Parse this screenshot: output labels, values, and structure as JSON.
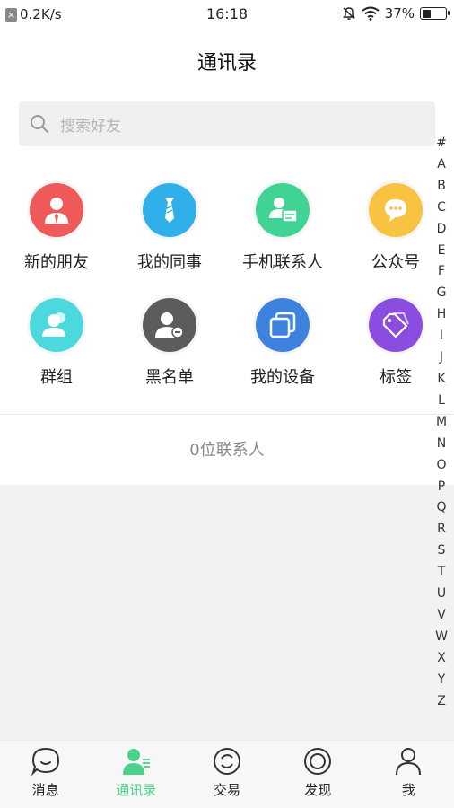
{
  "status": {
    "speed": "0.2K/s",
    "time": "16:18",
    "battery_pct": "37%",
    "battery_level": 0.37
  },
  "header": {
    "title": "通讯录"
  },
  "search": {
    "placeholder": "搜索好友"
  },
  "grid": [
    {
      "label": "新的朋友",
      "color": "#ee5a5a",
      "icon": "person-tie-icon"
    },
    {
      "label": "我的同事",
      "color": "#2fb0ea",
      "icon": "necktie-icon"
    },
    {
      "label": "手机联系人",
      "color": "#3fd494",
      "icon": "contact-card-icon"
    },
    {
      "label": "公众号",
      "color": "#f7c340",
      "icon": "chat-bubble-icon"
    },
    {
      "label": "群组",
      "color": "#4cd9dd",
      "icon": "group-icon"
    },
    {
      "label": "黑名单",
      "color": "#5c5c5c",
      "icon": "block-user-icon"
    },
    {
      "label": "我的设备",
      "color": "#3e82e0",
      "icon": "devices-icon"
    },
    {
      "label": "标签",
      "color": "#8a4de0",
      "icon": "tag-icon"
    }
  ],
  "contacts": {
    "count_text": "0位联系人"
  },
  "alphabet": [
    "#",
    "A",
    "B",
    "C",
    "D",
    "E",
    "F",
    "G",
    "H",
    "I",
    "J",
    "K",
    "L",
    "M",
    "N",
    "O",
    "P",
    "Q",
    "R",
    "S",
    "T",
    "U",
    "V",
    "W",
    "X",
    "Y",
    "Z"
  ],
  "tabs": [
    {
      "label": "消息",
      "active": false
    },
    {
      "label": "通讯录",
      "active": true
    },
    {
      "label": "交易",
      "active": false
    },
    {
      "label": "发现",
      "active": false
    },
    {
      "label": "我",
      "active": false
    }
  ]
}
